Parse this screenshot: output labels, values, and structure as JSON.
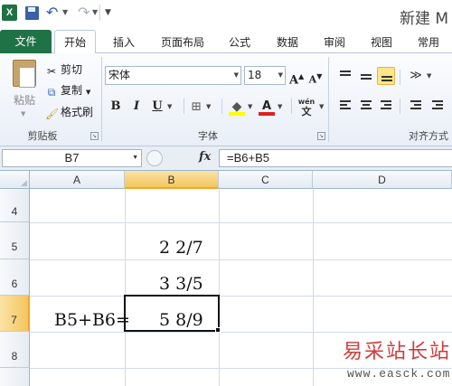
{
  "window": {
    "title": "新建 M",
    "app_logo": "X"
  },
  "quick_access": {
    "icons": [
      "save-icon",
      "undo-icon",
      "redo-icon",
      "customize-icon"
    ]
  },
  "ribbon_tabs": [
    {
      "label": "文件"
    },
    {
      "label": "开始"
    },
    {
      "label": "插入"
    },
    {
      "label": "页面布局"
    },
    {
      "label": "公式"
    },
    {
      "label": "数据"
    },
    {
      "label": "审阅"
    },
    {
      "label": "视图"
    },
    {
      "label": "常用"
    }
  ],
  "active_tab": "开始",
  "clipboard_group": {
    "label": "剪贴板",
    "paste": "粘贴",
    "cut": "剪切",
    "copy": "复制",
    "format_painter": "格式刷"
  },
  "font_group": {
    "label": "字体",
    "font_name": "宋体",
    "font_size": "18",
    "grow_font": "A",
    "shrink_font": "A",
    "bold": "B",
    "italic": "I",
    "underline": "U",
    "font_color_glyph": "A",
    "phonetic_glyph": "wén"
  },
  "alignment_group": {
    "label": "对齐方式"
  },
  "formula_bar": {
    "name_box": "B7",
    "fx": "fx",
    "formula": "=B6+B5"
  },
  "sheet": {
    "columns": [
      "A",
      "B",
      "C",
      "D"
    ],
    "selected_column": "B",
    "rows": [
      "4",
      "5",
      "6",
      "7",
      "8"
    ],
    "selected_row": "7",
    "cells": {
      "B5": "2 2/7",
      "B6": "3 3/5",
      "A7": "B5+B6=",
      "B7": "5 8/9"
    }
  },
  "watermark": {
    "brand": "易采站长站",
    "url": "www.easck.com"
  },
  "colors": {
    "file_tab": "#1f7246",
    "selection_header": "#f4c55d",
    "watermark": "#d23b3b"
  }
}
